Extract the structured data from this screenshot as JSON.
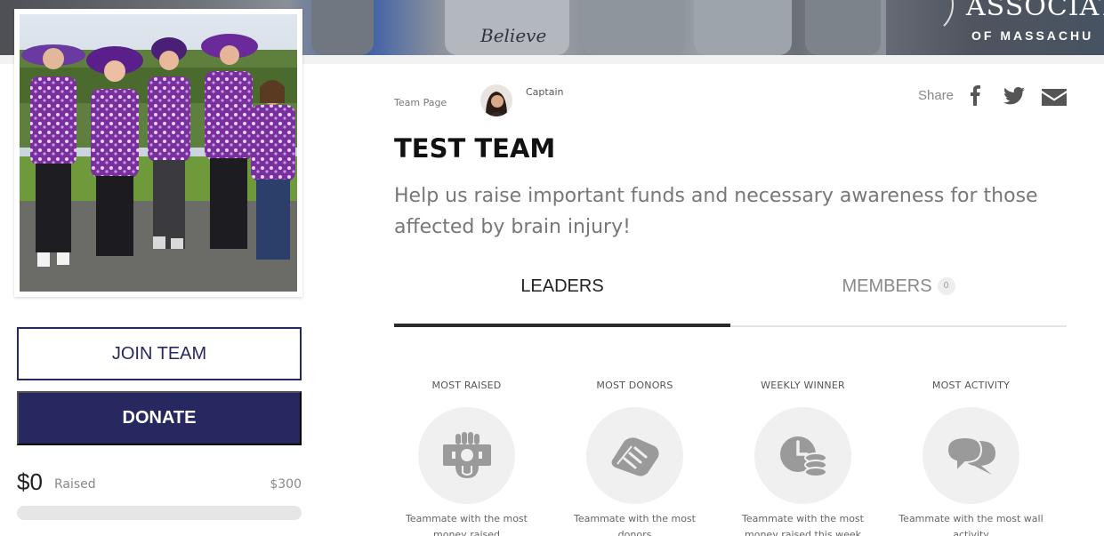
{
  "banner": {
    "logo_line1": "ASSOCIAT",
    "logo_line2": "OF MASSACHU",
    "shirt_text": "Believe"
  },
  "header": {
    "team_page_label": "Team Page",
    "captain_label": "Captain",
    "share_label": "Share",
    "share_icons": [
      "facebook-icon",
      "twitter-icon",
      "envelope-icon"
    ]
  },
  "team": {
    "title": "TEST TEAM",
    "description": "Help us raise important funds and necessary awareness for those affected by brain injury!"
  },
  "actions": {
    "join_label": "JOIN TEAM",
    "donate_label": "DONATE"
  },
  "fundraising": {
    "raised_amount": "$0",
    "raised_label": "Raised",
    "goal_amount": "$300",
    "progress_fraction": 0
  },
  "tabs": {
    "leaders_label": "LEADERS",
    "members_label": "MEMBERS",
    "members_count": "0",
    "active": "leaders"
  },
  "leaders": [
    {
      "title": "MOST RAISED",
      "icon": "money-hand-icon",
      "description": "Teammate with the most money raised"
    },
    {
      "title": "MOST DONORS",
      "icon": "handshake-icon",
      "description": "Teammate with the most donors"
    },
    {
      "title": "WEEKLY WINNER",
      "icon": "clock-coins-icon",
      "description": "Teammate with the most money raised this week"
    },
    {
      "title": "MOST ACTIVITY",
      "icon": "chat-bubbles-icon",
      "description": "Teammate with the most wall activity"
    }
  ],
  "colors": {
    "primary": "#27285f",
    "text_muted": "#777777",
    "icon_gray": "#9a9a9a",
    "icon_bg": "#f0f0f0",
    "progress_track": "#e6e6e6"
  }
}
